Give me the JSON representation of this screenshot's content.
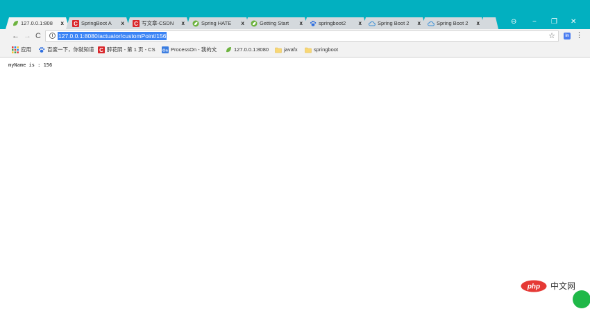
{
  "tabs": [
    {
      "title": "127.0.0.1:808",
      "icon": "spring-leaf-icon",
      "active": true
    },
    {
      "title": "SpringBoot A",
      "icon": "csdn-icon"
    },
    {
      "title": "写文章-CSDN",
      "icon": "csdn-icon"
    },
    {
      "title": "Spring HATE",
      "icon": "spring-leaf-icon"
    },
    {
      "title": "Getting Start",
      "icon": "spring-leaf-icon"
    },
    {
      "title": "springboot2",
      "icon": "paw-icon"
    },
    {
      "title": "Spring Boot 2",
      "icon": "cloud-icon"
    },
    {
      "title": "Spring Boot 2",
      "icon": "cloud-icon"
    }
  ],
  "tab_close_glyph": "x",
  "window_controls": {
    "account": "⊖",
    "minimize": "−",
    "restore": "❐",
    "close": "✕"
  },
  "nav": {
    "back": "←",
    "forward": "→",
    "reload": "C"
  },
  "omnibox": {
    "info": "i",
    "url": "127.0.0.1:8080/actuator/customPoint/156",
    "star": "☆"
  },
  "extension_label": "in",
  "menu_glyph": "⋮",
  "bookmarks": [
    {
      "label": "应用",
      "icon": "apps-grid-icon"
    },
    {
      "label": "百度一下，你就知道",
      "icon": "paw-icon"
    },
    {
      "label": "醉花阴 - 第 1 页 - CS",
      "icon": "csdn-icon"
    },
    {
      "label": "ProcessOn - 我的文",
      "icon": "processon-icon"
    },
    {
      "label": "127.0.0.1:8080",
      "icon": "spring-leaf-icon"
    },
    {
      "label": "javafx",
      "icon": "folder-icon"
    },
    {
      "label": "springboot",
      "icon": "folder-icon"
    }
  ],
  "page_text": "myName is : 156",
  "watermark": {
    "text": "中文网",
    "logo": "php"
  },
  "colors": {
    "tabstrip": "#02b0c0",
    "selection": "#3b84f5",
    "csdn_red": "#d9262a",
    "spring_green": "#6db33f"
  }
}
